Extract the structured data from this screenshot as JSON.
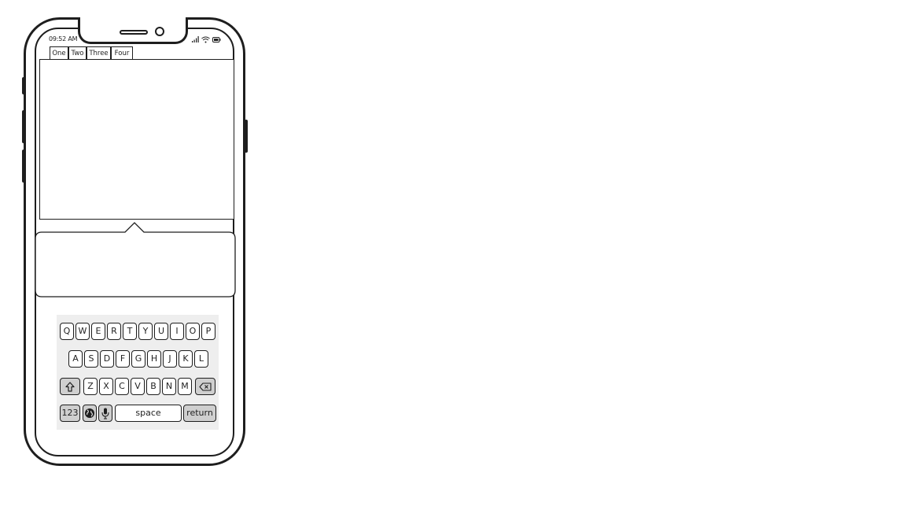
{
  "status_bar": {
    "time": "09:52 AM"
  },
  "tabs": [
    {
      "label": "One"
    },
    {
      "label": "Two"
    },
    {
      "label": "Three"
    },
    {
      "label": "Four"
    }
  ],
  "keyboard": {
    "row1": [
      "Q",
      "W",
      "E",
      "R",
      "T",
      "Y",
      "U",
      "I",
      "O",
      "P"
    ],
    "row2": [
      "A",
      "S",
      "D",
      "F",
      "G",
      "H",
      "J",
      "K",
      "L"
    ],
    "row3": [
      "Z",
      "X",
      "C",
      "V",
      "B",
      "N",
      "M"
    ],
    "numbers_label": "123",
    "space_label": "space",
    "return_label": "return",
    "icons": {
      "shift": "shift-icon",
      "backspace": "backspace-icon",
      "globe": "globe-icon",
      "mic": "microphone-icon"
    }
  }
}
